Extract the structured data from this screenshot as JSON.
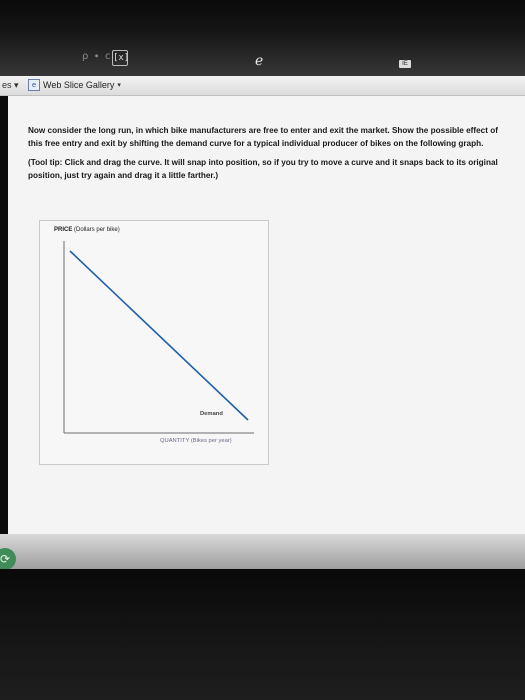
{
  "window": {
    "controls_text": "ρ ∙ c",
    "compat_icon": "[x]",
    "browser_icon": "edge-icon",
    "tab_badge": "IE"
  },
  "favorites_bar": {
    "left_text": "es ▾",
    "item_label": "Web Slice Gallery",
    "item_icon": "web-slice-icon"
  },
  "content": {
    "instructions": "Now consider the long run, in which bike manufacturers are free to enter and exit the market. Show the possible effect of this free entry and exit by shifting the demand curve for a typical individual producer of bikes on the following graph.",
    "tool_tip": "(Tool tip: Click and drag the curve. It will snap into position, so if you try to move a curve and it snaps back to its original position, just try again and drag it a little farther.)"
  },
  "graph": {
    "y_axis_label": "PRICE",
    "y_axis_unit": "(Dollars per bike)",
    "x_axis_label": "QUANTITY",
    "x_axis_unit": "(Bikes per year)",
    "curve_label": "Demand",
    "curve_color": "#1f5fa8"
  }
}
